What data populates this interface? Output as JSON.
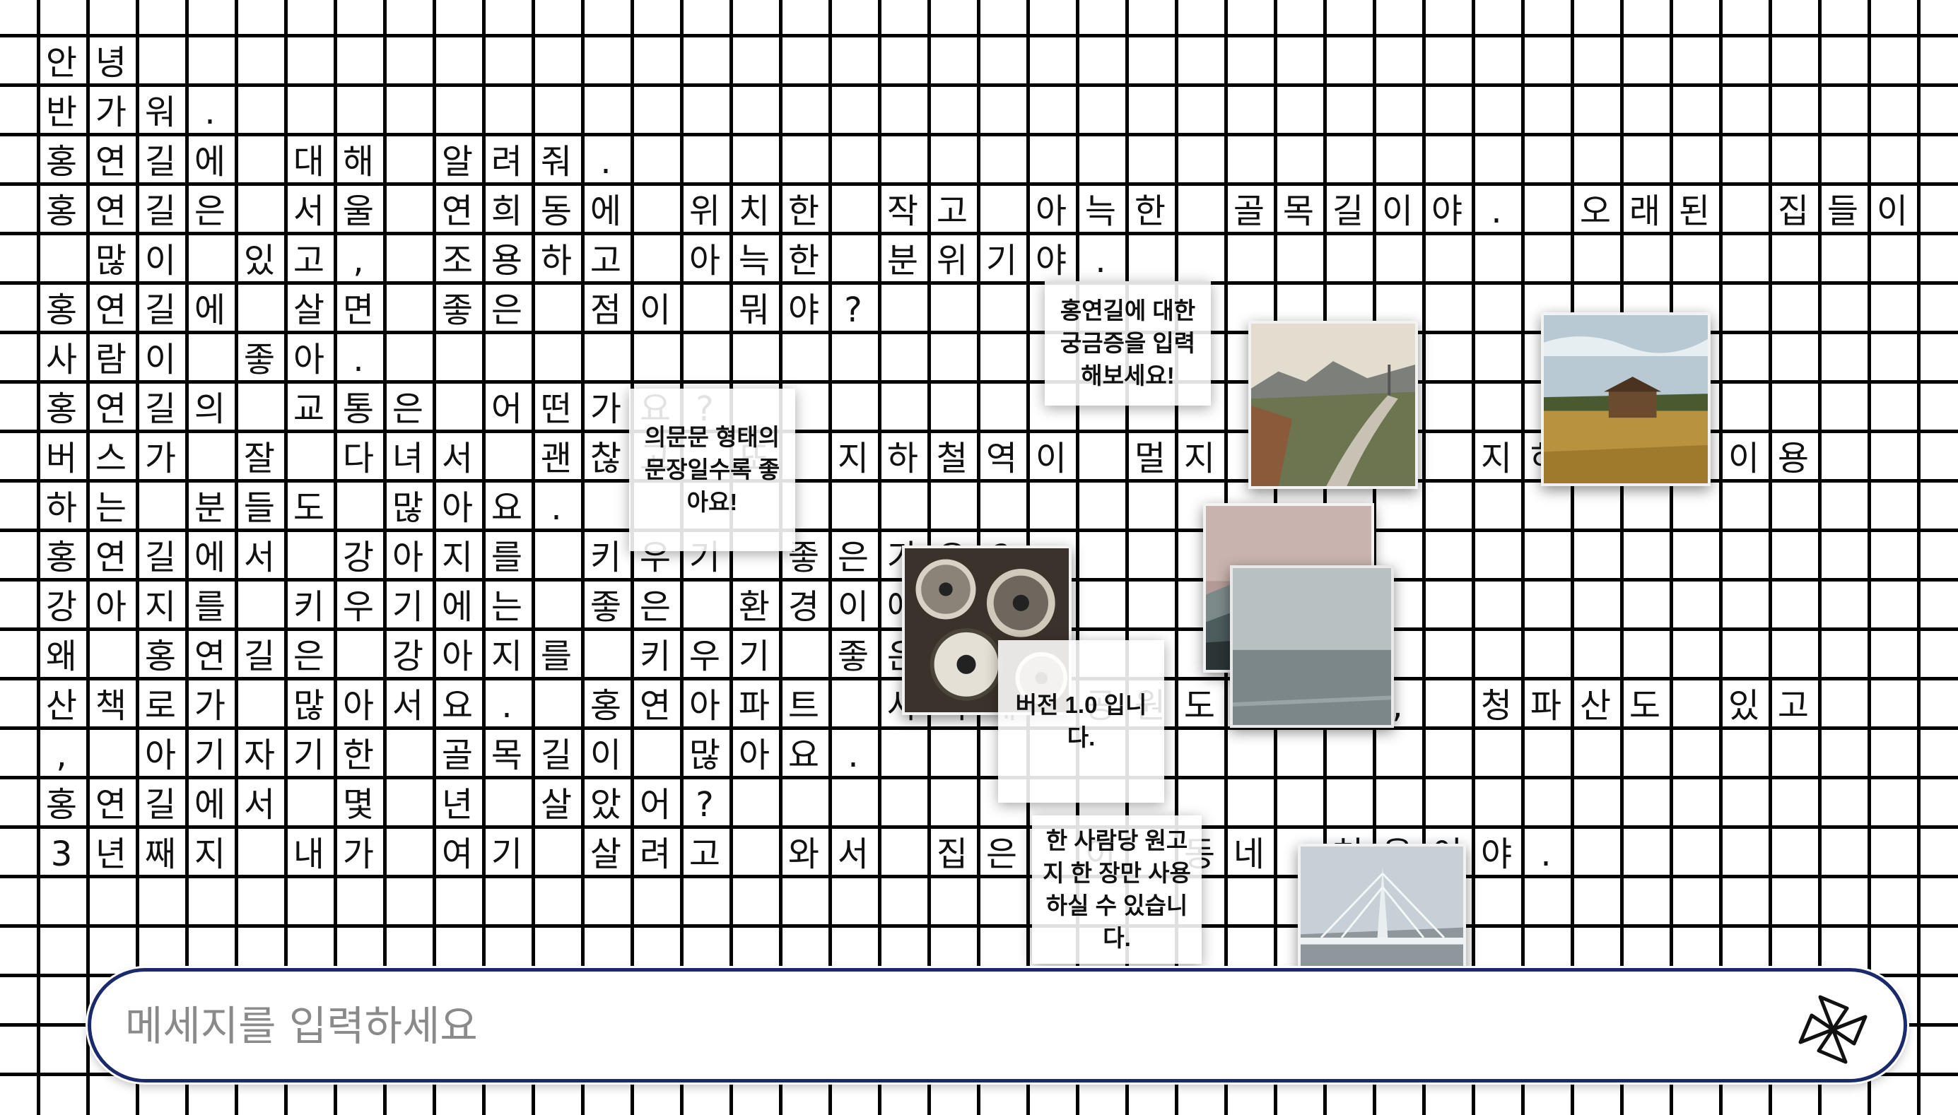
{
  "conversation": [
    "안녕",
    "반가워.",
    "홍연길에 대해 알려줘.",
    "홍연길은 서울 연희동에 위치한 작고 아늑한 골목길이야. 오래된 집들이",
    " 많이 있고, 조용하고 아늑한 분위기야.",
    "홍연길에 살면 좋은 점이 뭐야?",
    "사람이 좋아.",
    "홍연길의 교통은 어떤가요?",
    "버스가 잘 다녀서 괜찮고 또 지하철역이 멀지 않아서 지하철을 이용",
    "하는 분들도 많아요.",
    "홍연길에서 강아지를 키우기 좋은가요?",
    "강아지를 키우기에는 좋은 환경이에요.",
    "왜 홍연길은 강아지를 키우기 좋은가요?",
    "산책로가 많아서요. 홍연아파트 사이에 공원도 좋고, 청파산도 있고",
    ", 아기자기한 골목길이 많아요.",
    "홍연길에서 몇 년 살았어?",
    "3년째지 내가 여기 살려고 와서 집은 이 동네 처음이야."
  ],
  "notes": [
    {
      "name": "note-question-hint",
      "text": "홍연길에 대한 궁금증을 입력해보세요!"
    },
    {
      "name": "note-question-form",
      "text": "의문문 형태의 문장일수록 좋아요!"
    },
    {
      "name": "note-version",
      "text": "버전 1.0 입니다."
    },
    {
      "name": "note-usage-limit",
      "text": "한 사람당 원고지 한 장만 사용하실 수 있습니다."
    }
  ],
  "photos": [
    {
      "name": "photo-mountain-road",
      "icon": "mountain-road-photo"
    },
    {
      "name": "photo-field-house",
      "icon": "field-house-photo"
    },
    {
      "name": "photo-misty-hills",
      "icon": "misty-hills-photo"
    },
    {
      "name": "photo-film-reels",
      "icon": "film-reels-photo"
    },
    {
      "name": "photo-lake",
      "icon": "lake-photo"
    },
    {
      "name": "photo-bridge",
      "icon": "bridge-photo"
    }
  ],
  "chat": {
    "placeholder": "메세지를 입력하세요",
    "value": "",
    "send_icon": "pinwheel-send-icon"
  },
  "colors": {
    "grid": "#000000",
    "chat_border": "#1a2a6c",
    "text": "#111111",
    "placeholder": "#8a8a8a"
  }
}
